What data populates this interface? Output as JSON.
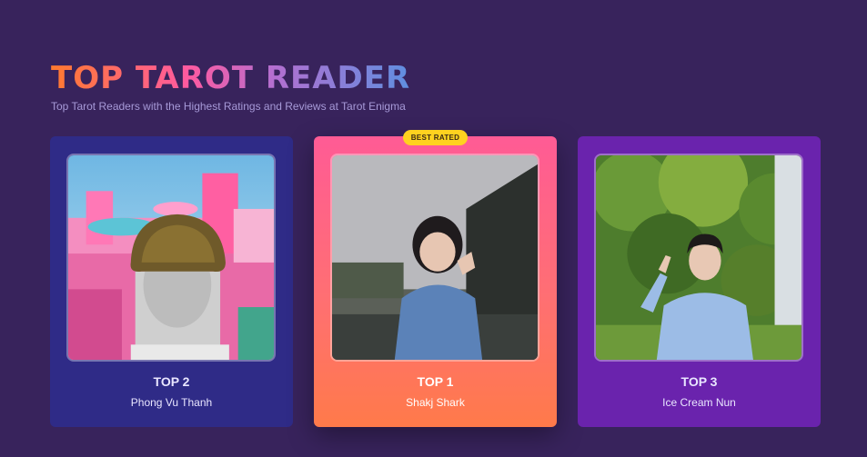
{
  "header": {
    "title": "TOP TAROT READER",
    "subtitle": "Top Tarot Readers with the Highest Ratings and Reviews at Tarot Enigma"
  },
  "cards": [
    {
      "rank": "TOP 2",
      "name": "Phong Vu Thanh",
      "photo_icon": "reader-photo"
    },
    {
      "rank": "TOP 1",
      "name": "Shakj Shark",
      "badge": "BEST RATED",
      "photo_icon": "reader-photo"
    },
    {
      "rank": "TOP 3",
      "name": "Ice Cream Nun",
      "photo_icon": "reader-photo"
    }
  ],
  "colors": {
    "background": "#38235c",
    "card_top2": "#2f2b87",
    "card_top1_start": "#ff5b95",
    "card_top1_end": "#ff7a4a",
    "card_top3": "#6a23ad",
    "badge": "#ffd21f"
  }
}
